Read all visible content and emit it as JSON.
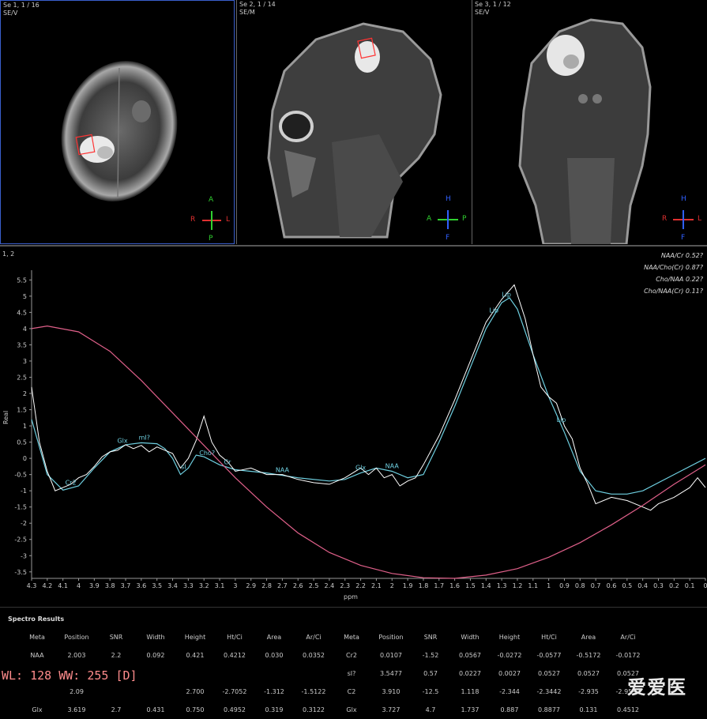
{
  "viewports": [
    {
      "label": "Se 1, 1 / 16\nSE/V",
      "orient": {
        "top": "A",
        "left": "R",
        "right": "L",
        "bottom": "P"
      }
    },
    {
      "label": "Se 2, 1 / 14\nSE/M",
      "orient": {
        "top": "H",
        "left": "A",
        "right": "P",
        "bottom": "F"
      }
    },
    {
      "label": "Se 3, 1 / 12\nSE/V",
      "orient": {
        "top": "H",
        "left": "R",
        "right": "L",
        "bottom": "F"
      }
    }
  ],
  "colors": {
    "orient_red": "#e03030",
    "orient_green": "#30d030",
    "orient_blue": "#3060ff",
    "fit": "#6ecfe0",
    "baseline": "#e0608a",
    "raw": "#ffffff",
    "selection": "#ff3333",
    "active_border": "#3a5fcd"
  },
  "spectrum": {
    "panel_label": "1, 2",
    "ratios": [
      "NAA/Cr  0.52?",
      "NAA/Cho(Cr)  0.87?",
      "Cho/NAA  0.22?",
      "Cho/NAA(Cr)  0.11?"
    ],
    "ylabel": "Real",
    "xlabel": "ppm",
    "peak_labels": [
      "Cr2",
      "Glx",
      "mI?",
      "sI",
      "Cho?",
      "Cr",
      "NAA",
      "Glx",
      "NAA",
      "Lip",
      "Lip",
      "Lip"
    ]
  },
  "chart_data": {
    "type": "line",
    "x_axis": {
      "label": "ppm",
      "reversed": true,
      "range": [
        4.3,
        0
      ],
      "ticks": [
        "4.3",
        "4.2",
        "4.1",
        "4",
        "3.9",
        "3.8",
        "3.7",
        "3.6",
        "3.5",
        "3.4",
        "3.3",
        "3.2",
        "3.1",
        "3",
        "2.9",
        "2.8",
        "2.7",
        "2.6",
        "2.5",
        "2.4",
        "2.3",
        "2.2",
        "2.1",
        "2",
        "1.9",
        "1.8",
        "1.7",
        "1.6",
        "1.5",
        "1.4",
        "1.3",
        "1.2",
        "1.1",
        "1",
        "0.9",
        "0.8",
        "0.7",
        "0.6",
        "0.5",
        "0.4",
        "0.3",
        "0.2",
        "0.1",
        "0"
      ]
    },
    "y_axis": {
      "label": "Real",
      "range": [
        -3.7,
        5.8
      ],
      "ticks": [
        "5.5",
        "5",
        "4.5",
        "4",
        "3.5",
        "3",
        "2.5",
        "2",
        "1.5",
        "1",
        "0.5",
        "0",
        "-0.5",
        "-1",
        "-1.5",
        "-2",
        "-2.5",
        "-3",
        "-3.5"
      ]
    },
    "series": [
      {
        "role": "fit",
        "points": [
          [
            4.3,
            1.2
          ],
          [
            4.2,
            -0.5
          ],
          [
            4.1,
            -0.98
          ],
          [
            4.0,
            -0.85
          ],
          [
            3.9,
            -0.3
          ],
          [
            3.8,
            0.2
          ],
          [
            3.7,
            0.42
          ],
          [
            3.6,
            0.48
          ],
          [
            3.5,
            0.45
          ],
          [
            3.45,
            0.3
          ],
          [
            3.4,
            0.0
          ],
          [
            3.35,
            -0.5
          ],
          [
            3.3,
            -0.3
          ],
          [
            3.25,
            0.1
          ],
          [
            3.2,
            0.05
          ],
          [
            3.1,
            -0.2
          ],
          [
            3.0,
            -0.35
          ],
          [
            2.8,
            -0.45
          ],
          [
            2.6,
            -0.6
          ],
          [
            2.4,
            -0.7
          ],
          [
            2.3,
            -0.65
          ],
          [
            2.2,
            -0.45
          ],
          [
            2.1,
            -0.3
          ],
          [
            2.0,
            -0.4
          ],
          [
            1.9,
            -0.6
          ],
          [
            1.8,
            -0.5
          ],
          [
            1.7,
            0.5
          ],
          [
            1.6,
            1.6
          ],
          [
            1.5,
            2.8
          ],
          [
            1.4,
            4.0
          ],
          [
            1.3,
            4.8
          ],
          [
            1.25,
            4.95
          ],
          [
            1.2,
            4.6
          ],
          [
            1.1,
            3.2
          ],
          [
            1.0,
            1.9
          ],
          [
            0.9,
            0.8
          ],
          [
            0.8,
            -0.4
          ],
          [
            0.7,
            -1.0
          ],
          [
            0.6,
            -1.1
          ],
          [
            0.5,
            -1.1
          ],
          [
            0.4,
            -1.0
          ],
          [
            0.2,
            -0.5
          ],
          [
            0.0,
            0.0
          ]
        ]
      },
      {
        "role": "raw",
        "points": [
          [
            4.3,
            2.2
          ],
          [
            4.25,
            0.5
          ],
          [
            4.2,
            -0.4
          ],
          [
            4.15,
            -1.0
          ],
          [
            4.1,
            -0.9
          ],
          [
            4.05,
            -0.8
          ],
          [
            4.0,
            -0.6
          ],
          [
            3.95,
            -0.5
          ],
          [
            3.9,
            -0.25
          ],
          [
            3.85,
            0.05
          ],
          [
            3.8,
            0.2
          ],
          [
            3.75,
            0.25
          ],
          [
            3.7,
            0.42
          ],
          [
            3.65,
            0.3
          ],
          [
            3.6,
            0.4
          ],
          [
            3.55,
            0.2
          ],
          [
            3.5,
            0.35
          ],
          [
            3.45,
            0.25
          ],
          [
            3.4,
            0.15
          ],
          [
            3.35,
            -0.3
          ],
          [
            3.3,
            0.0
          ],
          [
            3.25,
            0.55
          ],
          [
            3.2,
            1.3
          ],
          [
            3.15,
            0.5
          ],
          [
            3.1,
            0.1
          ],
          [
            3.05,
            -0.1
          ],
          [
            3.0,
            -0.4
          ],
          [
            2.9,
            -0.3
          ],
          [
            2.8,
            -0.5
          ],
          [
            2.7,
            -0.5
          ],
          [
            2.6,
            -0.65
          ],
          [
            2.5,
            -0.75
          ],
          [
            2.4,
            -0.8
          ],
          [
            2.3,
            -0.6
          ],
          [
            2.2,
            -0.3
          ],
          [
            2.15,
            -0.5
          ],
          [
            2.1,
            -0.3
          ],
          [
            2.05,
            -0.6
          ],
          [
            2.0,
            -0.5
          ],
          [
            1.95,
            -0.85
          ],
          [
            1.9,
            -0.7
          ],
          [
            1.85,
            -0.6
          ],
          [
            1.8,
            -0.2
          ],
          [
            1.7,
            0.7
          ],
          [
            1.6,
            1.8
          ],
          [
            1.5,
            3.0
          ],
          [
            1.4,
            4.2
          ],
          [
            1.3,
            4.9
          ],
          [
            1.22,
            5.35
          ],
          [
            1.15,
            4.3
          ],
          [
            1.1,
            3.2
          ],
          [
            1.05,
            2.2
          ],
          [
            1.0,
            1.9
          ],
          [
            0.95,
            1.7
          ],
          [
            0.9,
            1.0
          ],
          [
            0.85,
            0.6
          ],
          [
            0.8,
            -0.3
          ],
          [
            0.75,
            -0.8
          ],
          [
            0.7,
            -1.4
          ],
          [
            0.6,
            -1.2
          ],
          [
            0.5,
            -1.3
          ],
          [
            0.4,
            -1.5
          ],
          [
            0.35,
            -1.6
          ],
          [
            0.3,
            -1.4
          ],
          [
            0.2,
            -1.2
          ],
          [
            0.1,
            -0.9
          ],
          [
            0.05,
            -0.6
          ],
          [
            0.0,
            -0.9
          ]
        ]
      },
      {
        "role": "baseline",
        "points": [
          [
            4.3,
            4.0
          ],
          [
            4.2,
            4.08
          ],
          [
            4.0,
            3.9
          ],
          [
            3.8,
            3.3
          ],
          [
            3.6,
            2.4
          ],
          [
            3.4,
            1.4
          ],
          [
            3.2,
            0.4
          ],
          [
            3.0,
            -0.6
          ],
          [
            2.8,
            -1.5
          ],
          [
            2.6,
            -2.3
          ],
          [
            2.4,
            -2.9
          ],
          [
            2.2,
            -3.3
          ],
          [
            2.0,
            -3.55
          ],
          [
            1.8,
            -3.68
          ],
          [
            1.6,
            -3.7
          ],
          [
            1.4,
            -3.6
          ],
          [
            1.2,
            -3.4
          ],
          [
            1.0,
            -3.05
          ],
          [
            0.8,
            -2.6
          ],
          [
            0.6,
            -2.05
          ],
          [
            0.4,
            -1.45
          ],
          [
            0.2,
            -0.8
          ],
          [
            0.0,
            -0.2
          ]
        ]
      }
    ]
  },
  "results": {
    "title": "Spectro Results",
    "headers": [
      "Meta",
      "Position",
      "SNR",
      "Width",
      "Height",
      "Ht/Ci",
      "Area",
      "Ar/Ci"
    ],
    "left_rows": [
      [
        "NAA",
        "2.003",
        "2.2",
        "0.092",
        "0.421",
        "0.4212",
        "0.030",
        "0.0352"
      ],
      [
        "",
        "",
        "",
        "",
        "",
        "",
        "",
        ""
      ],
      [
        "",
        "2.09",
        "",
        "",
        "2.700",
        "-2.7052",
        "-1.312",
        "-1.5122"
      ],
      [
        "Glx",
        "3.619",
        "2.7",
        "0.431",
        "0.750",
        "0.4952",
        "0.319",
        "0.3122"
      ]
    ],
    "right_rows": [
      [
        "Cr2",
        "0.0107",
        "-1.52",
        "0.0567",
        "-0.0272",
        "-0.0577",
        "-0.5172",
        "-0.0172"
      ],
      [
        "sI?",
        "3.5477",
        "0.57",
        "0.0227",
        "0.0027",
        "0.0527",
        "0.0527",
        "0.0527"
      ],
      [
        "C2",
        "3.910",
        "-12.5",
        "1.118",
        "-2.344",
        "-2.3442",
        "-2.935",
        "-2.9592"
      ],
      [
        "Glx",
        "3.727",
        "4.7",
        "1.737",
        "0.887",
        "0.8877",
        "0.131",
        "0.4512"
      ]
    ]
  },
  "window_level": "WL: 128 WW: 255 [D]",
  "watermark": "爱爱医"
}
